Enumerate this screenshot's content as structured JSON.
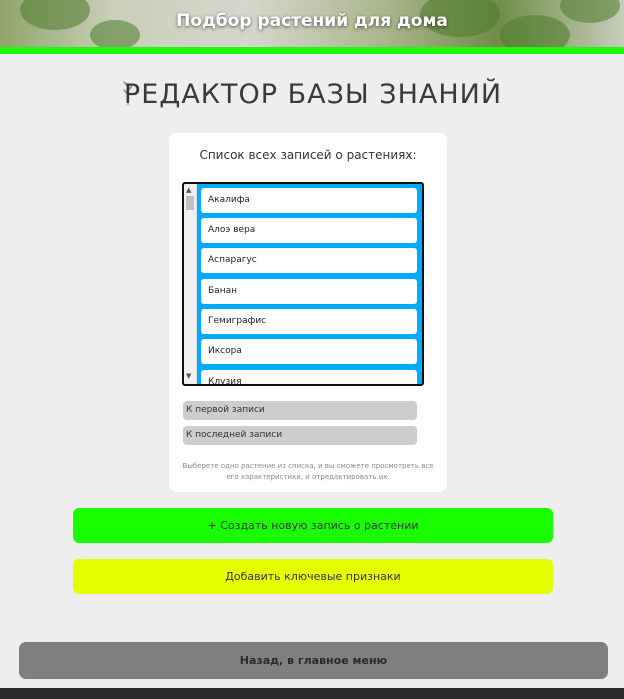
{
  "header": {
    "title": "Подбор растений для дома"
  },
  "page": {
    "title": "РЕДАКТОР БАЗЫ ЗНАНИЙ"
  },
  "card": {
    "heading": "Список всех записей о растениях:",
    "items": [
      {
        "label": "Акалифа"
      },
      {
        "label": "Алоэ вера"
      },
      {
        "label": "Аспарагус"
      },
      {
        "label": "Банан"
      },
      {
        "label": "Гемиграфис"
      },
      {
        "label": "Иксора"
      },
      {
        "label": "Клузия"
      }
    ],
    "first_record_label": "К первой записи",
    "last_record_label": "К последней записи",
    "hint": "Выберете одно растение из списка, и вы сможете просмотреть все его характеристики, и отредактировать их."
  },
  "actions": {
    "create_label": "+ Создать новую запись о растении",
    "add_features_label": "Добавить ключевые признаки",
    "back_label": "Назад, в главное меню"
  },
  "colors": {
    "accent_green": "#1aff00",
    "create_button": "#1aff00",
    "features_button": "#e6ff00",
    "list_background": "#00aaff",
    "back_button": "#7f7f7f"
  }
}
